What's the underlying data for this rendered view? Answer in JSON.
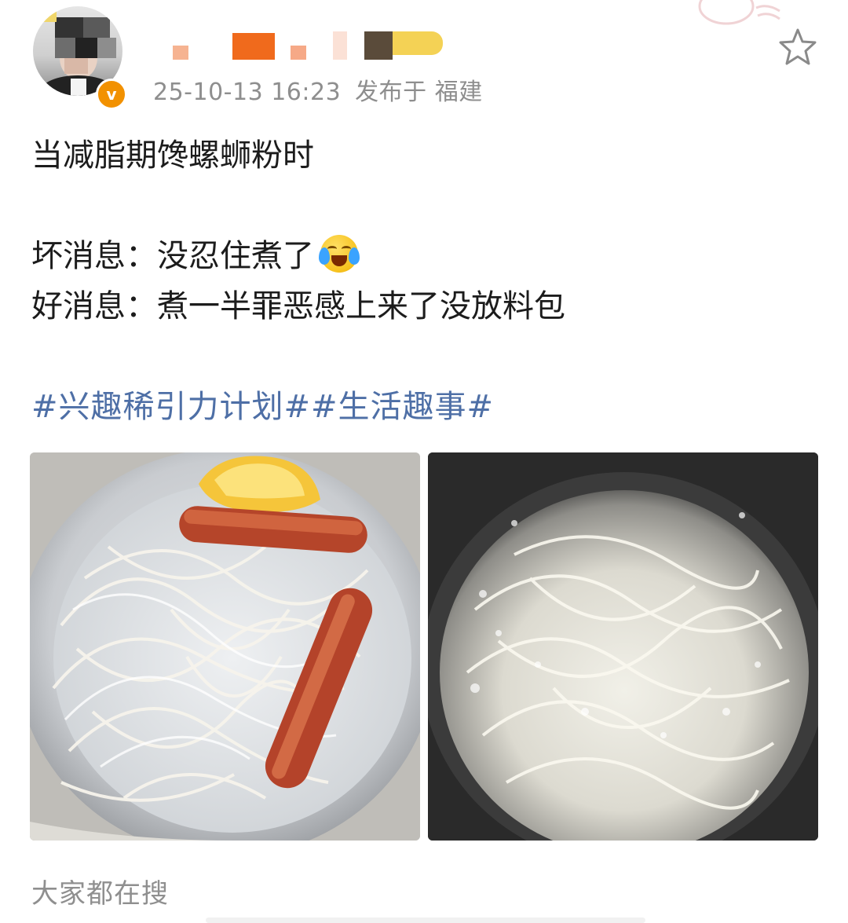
{
  "post": {
    "timestamp": "25-10-13 16:23",
    "location_label": "发布于 福建",
    "text_lines": [
      "当减脂期馋螺蛳粉时",
      "坏消息：没忍住煮了",
      "好消息：煮一半罪恶感上来了没放料包"
    ],
    "emoji_name": "crying-laughing-emoji",
    "topics": [
      "#兴趣稀引力计划#",
      "#生活趣事#"
    ]
  },
  "icons": {
    "favorite": "star-icon",
    "verified": "verified-badge-icon"
  },
  "colors": {
    "topic_link": "#4e6fa6",
    "meta_text": "#8e8e8e",
    "verified_badge": "#f29100"
  },
  "footer": {
    "search_label": "大家都在搜"
  }
}
